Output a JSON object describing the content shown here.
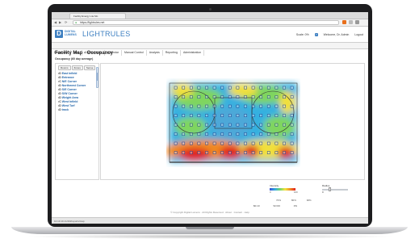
{
  "browser": {
    "tab_title": "Facility Energy Lite Mo",
    "url": "https://lightrules.net",
    "back": "◀",
    "forward": "▶",
    "reload": "⟳"
  },
  "app": {
    "logo_line1": "DIGITAL",
    "logo_line2": "LUMENS",
    "product": "LIGHTRULES",
    "header_right": {
      "scale": "Scale: 0%",
      "welcome": "Welcome, Dr. Admin",
      "logout": "Logout"
    }
  },
  "menu": [
    "Dashboard",
    "Map",
    "Configuration",
    "Calendar",
    "Manual Control",
    "Analysis",
    "Reporting",
    "Administration"
  ],
  "menu_active": "Reporting",
  "page": {
    "title": "Facility Map - Occupancy",
    "subtitle": "Occupancy (60 day average)"
  },
  "sidebar": {
    "controls": [
      "Rooms",
      "Zones",
      "Sense"
    ],
    "zones": [
      {
        "tag": "•D",
        "label": "East Infield"
      },
      {
        "tag": "•D",
        "label": "Entrance"
      },
      {
        "tag": "•C",
        "label": "N/E Corner"
      },
      {
        "tag": "•D",
        "label": "Northwest Corner"
      },
      {
        "tag": "•D",
        "label": "S/E Corner"
      },
      {
        "tag": "•D",
        "label": "S/W Corner"
      },
      {
        "tag": "•D",
        "label": "Weight Area"
      },
      {
        "tag": "•C",
        "label": "West Infield"
      },
      {
        "tag": "•D",
        "label": "West Turf"
      },
      {
        "tag": "•D",
        "label": "track"
      }
    ]
  },
  "legend": {
    "label": "Intensity",
    "ticks": [
      "0",
      "100"
    ],
    "radius_label": "Radius",
    "radius_value": "0",
    "pct_labels": [
      "70%",
      "80%",
      "90%"
    ]
  },
  "bottom_values": [
    "$0.10",
    "SO:00",
    "0%"
  ],
  "footer": "© Copyright Digital Lumens · All Rights Reserved · About · Contact · Help",
  "status": "10.10.10.1/v3/#/reports/map",
  "colors": {
    "brand": "#3d7fc1",
    "heat_low": "#3a4fd6",
    "heat_high": "#e02020"
  }
}
